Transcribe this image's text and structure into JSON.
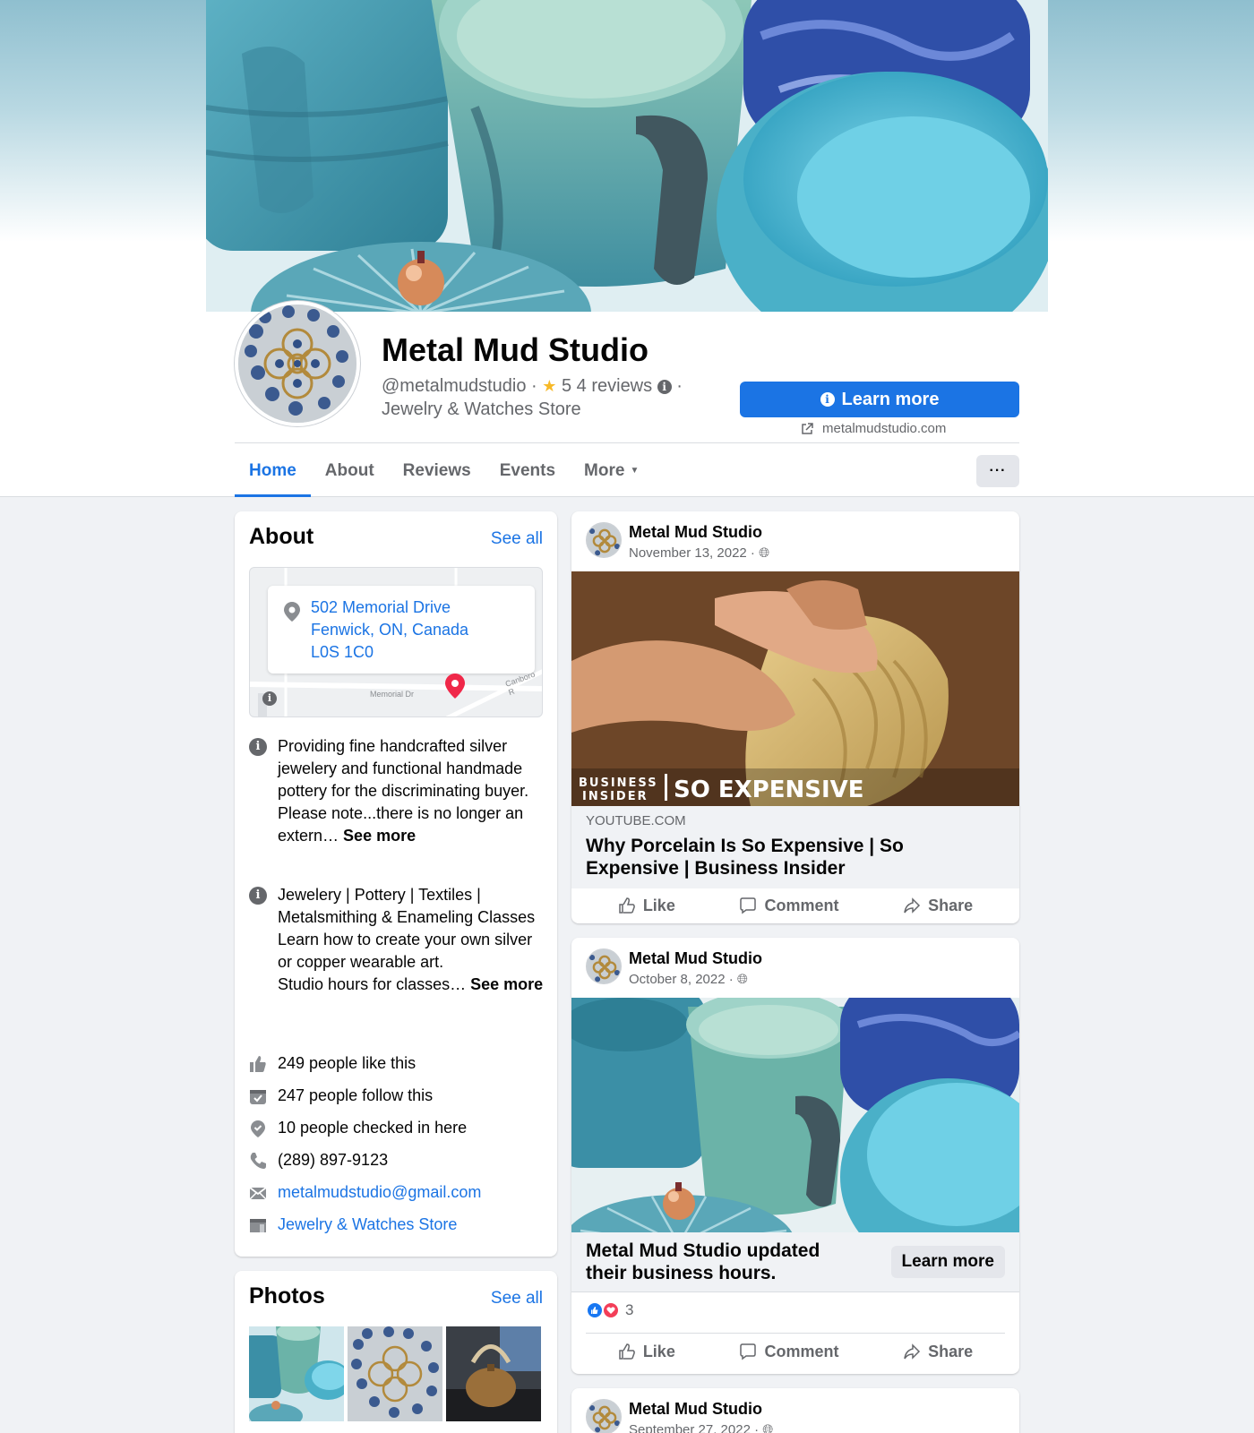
{
  "page": {
    "name": "Metal Mud Studio",
    "handle": "@metalmudstudio",
    "rating_text": "5",
    "reviews_text": "4 reviews",
    "category": "Jewelry & Watches Store",
    "cta_label": "Learn more",
    "website": "metalmudstudio.com"
  },
  "tabs": [
    {
      "label": "Home",
      "active": true
    },
    {
      "label": "About"
    },
    {
      "label": "Reviews"
    },
    {
      "label": "Events"
    },
    {
      "label": "More"
    }
  ],
  "more_button": "···",
  "about": {
    "title": "About",
    "see_all": "See all",
    "address_line1": "502 Memorial Drive",
    "address_line2": "Fenwick, ON, Canada",
    "address_line3": "L0S 1C0",
    "map_street": "Memorial Dr",
    "map_street2": "Canboro R",
    "description": {
      "line1": "Providing fine handcrafted silver jewelery and functional handmade pottery for the discriminating buyer.",
      "line2": "Please note...there is no longer an extern…",
      "see_more": "See more"
    },
    "services": {
      "line1": "Jewelery | Pottery | Textiles | Metalsmithing & Enameling Classes",
      "line2": "Learn how to create your own silver or copper wearable art.",
      "line3": "Studio hours for classes…",
      "see_more": "See more"
    },
    "likes": "249 people like this",
    "follows": "247 people follow this",
    "checkins": "10 people checked in here",
    "phone": "(289) 897-9123",
    "email": "metalmudstudio@gmail.com",
    "category_link": "Jewelry & Watches Store"
  },
  "photos": {
    "title": "Photos",
    "see_all": "See all"
  },
  "posts": [
    {
      "author": "Metal Mud Studio",
      "date": "November 13, 2022 ·",
      "media_brand_top": "BUSINESS",
      "media_brand_bottom": "INSIDER",
      "media_series": "SO EXPENSIVE",
      "link_domain": "YOUTUBE.COM",
      "link_title": "Why Porcelain Is So Expensive | So Expensive | Business Insider"
    },
    {
      "author": "Metal Mud Studio",
      "date": "October 8, 2022 ·",
      "update_text": "Metal Mud Studio updated their business hours.",
      "update_button": "Learn more",
      "reaction_count": "3"
    },
    {
      "author": "Metal Mud Studio",
      "date": "September 27, 2022 ·"
    }
  ],
  "actions": {
    "like": "Like",
    "comment": "Comment",
    "share": "Share"
  },
  "colors": {
    "accent": "#1b74e4",
    "background": "#f0f2f5",
    "text_secondary": "#65676b",
    "star": "#f7b928"
  }
}
